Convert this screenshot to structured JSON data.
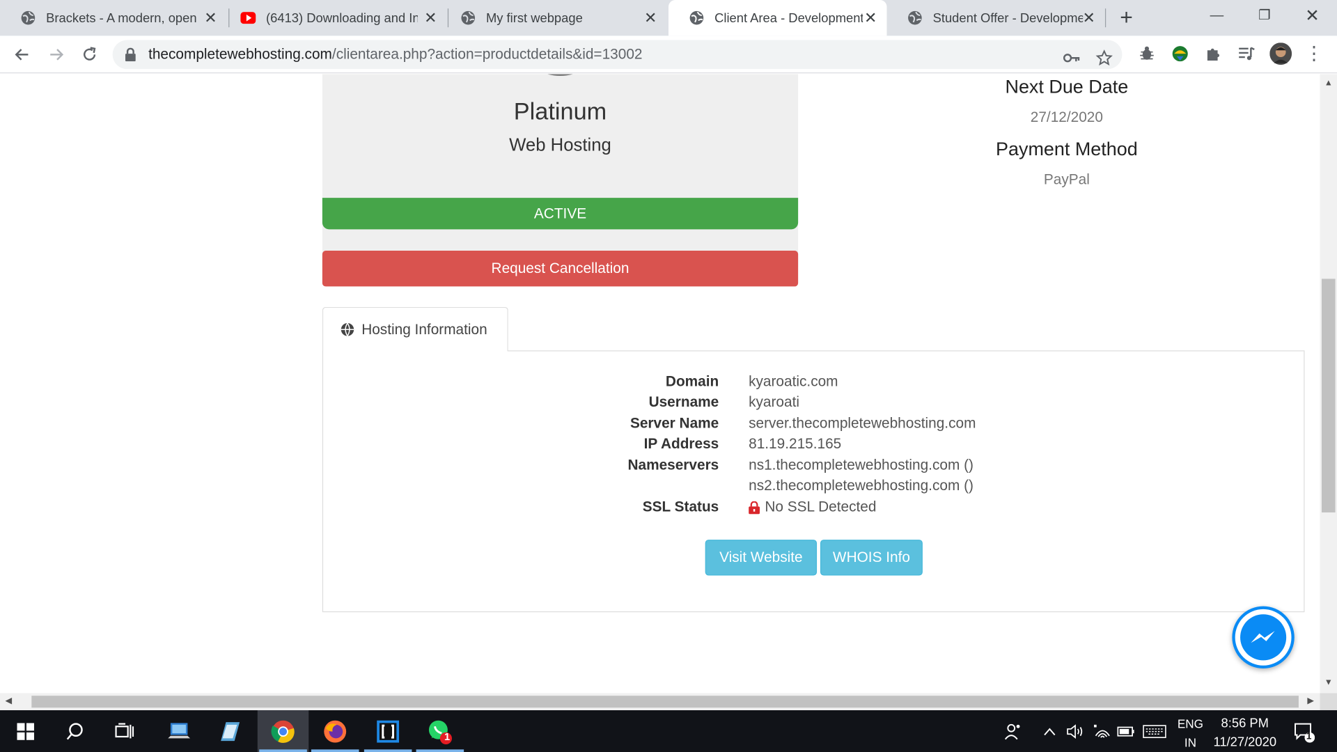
{
  "browser": {
    "tabs": [
      {
        "label": "Brackets - A modern, open",
        "icon": "globe-icon"
      },
      {
        "label": "(6413) Downloading and In",
        "icon": "youtube-icon"
      },
      {
        "label": "My first webpage",
        "icon": "globe-icon"
      },
      {
        "label": "Client Area - Development",
        "icon": "globe-icon",
        "active": true
      },
      {
        "label": "Student Offer - Developme",
        "icon": "globe-icon"
      }
    ],
    "url_host": "thecompletewebhosting.com",
    "url_rest": "/clientarea.php?action=productdetails&id=13002"
  },
  "product": {
    "name": "Platinum",
    "type": "Web Hosting",
    "status": "ACTIVE",
    "cancel_label": "Request Cancellation"
  },
  "billing": {
    "due_heading": "Next Due Date",
    "due_value": "27/12/2020",
    "payment_heading": "Payment Method",
    "payment_value": "PayPal"
  },
  "hosting": {
    "tab_label": "Hosting Information",
    "rows": [
      {
        "label": "Domain",
        "value": "kyaroatic.com"
      },
      {
        "label": "Username",
        "value": "kyaroati"
      },
      {
        "label": "Server Name",
        "value": "server.thecompletewebhosting.com"
      },
      {
        "label": "IP Address",
        "value": "81.19.215.165"
      },
      {
        "label": "Nameservers",
        "value": "ns1.thecompletewebhosting.com ()"
      },
      {
        "label": "",
        "value": "ns2.thecompletewebhosting.com ()"
      },
      {
        "label": "SSL Status",
        "value": "No SSL Detected"
      }
    ],
    "visit_label": "Visit Website",
    "whois_label": "WHOIS Info"
  },
  "taskbar": {
    "lang_top": "ENG",
    "lang_bottom": "IN",
    "time": "8:56 PM",
    "date": "11/27/2020",
    "whatsapp_badge": "1",
    "notif_badge": "1"
  },
  "colors": {
    "active_green": "#46a549",
    "danger_red": "#d9534f",
    "info_blue": "#5bc0de",
    "messenger_blue": "#0a8bf5"
  }
}
